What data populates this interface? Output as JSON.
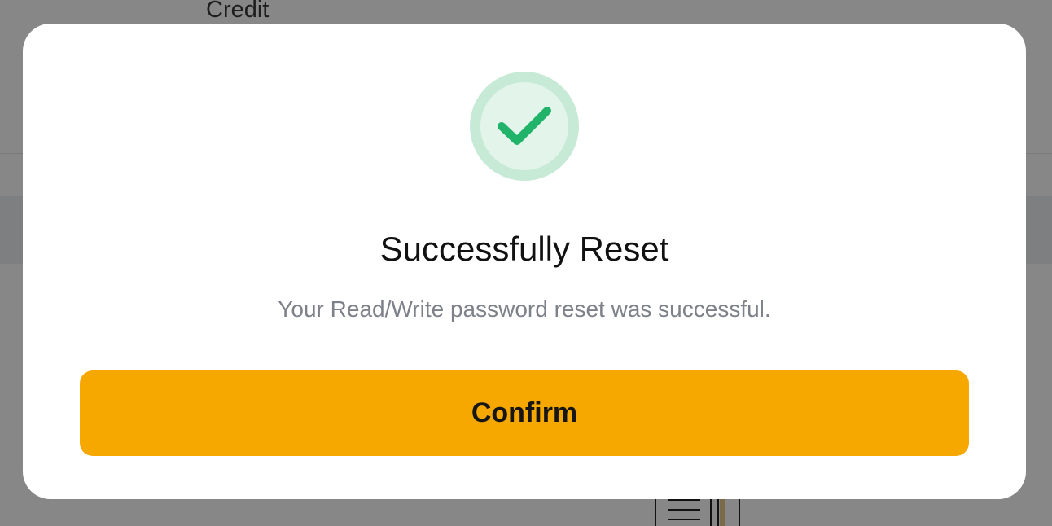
{
  "background": {
    "credit_label": "Credit"
  },
  "dialog": {
    "icon": "checkmark-icon",
    "title": "Successfully Reset",
    "message": "Your Read/Write password reset was successful.",
    "confirm_label": "Confirm"
  },
  "colors": {
    "accent": "#f7a800",
    "success_green": "#22b36b",
    "success_ring": "#c6ead6",
    "success_fill": "#e3f4ea",
    "message_text": "#7d8189"
  }
}
